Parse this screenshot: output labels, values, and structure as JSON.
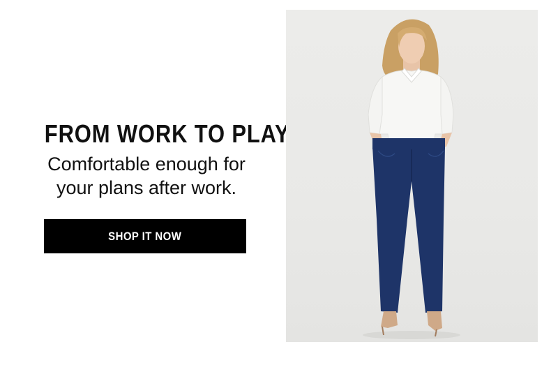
{
  "promo": {
    "headline": "FROM WORK TO PLAY",
    "subline_1": "Comfortable enough for",
    "subline_2": "your plans after work.",
    "cta_label": "SHOP IT NOW"
  },
  "colors": {
    "text": "#111111",
    "cta_background": "#000000",
    "cta_text": "#ffffff",
    "photo_background": "#ebebe9",
    "jeans": "#1e3468",
    "shirt": "#f7f7f5"
  },
  "image": {
    "subject": "model-wearing-white-shirt-and-dark-blue-jeans"
  }
}
